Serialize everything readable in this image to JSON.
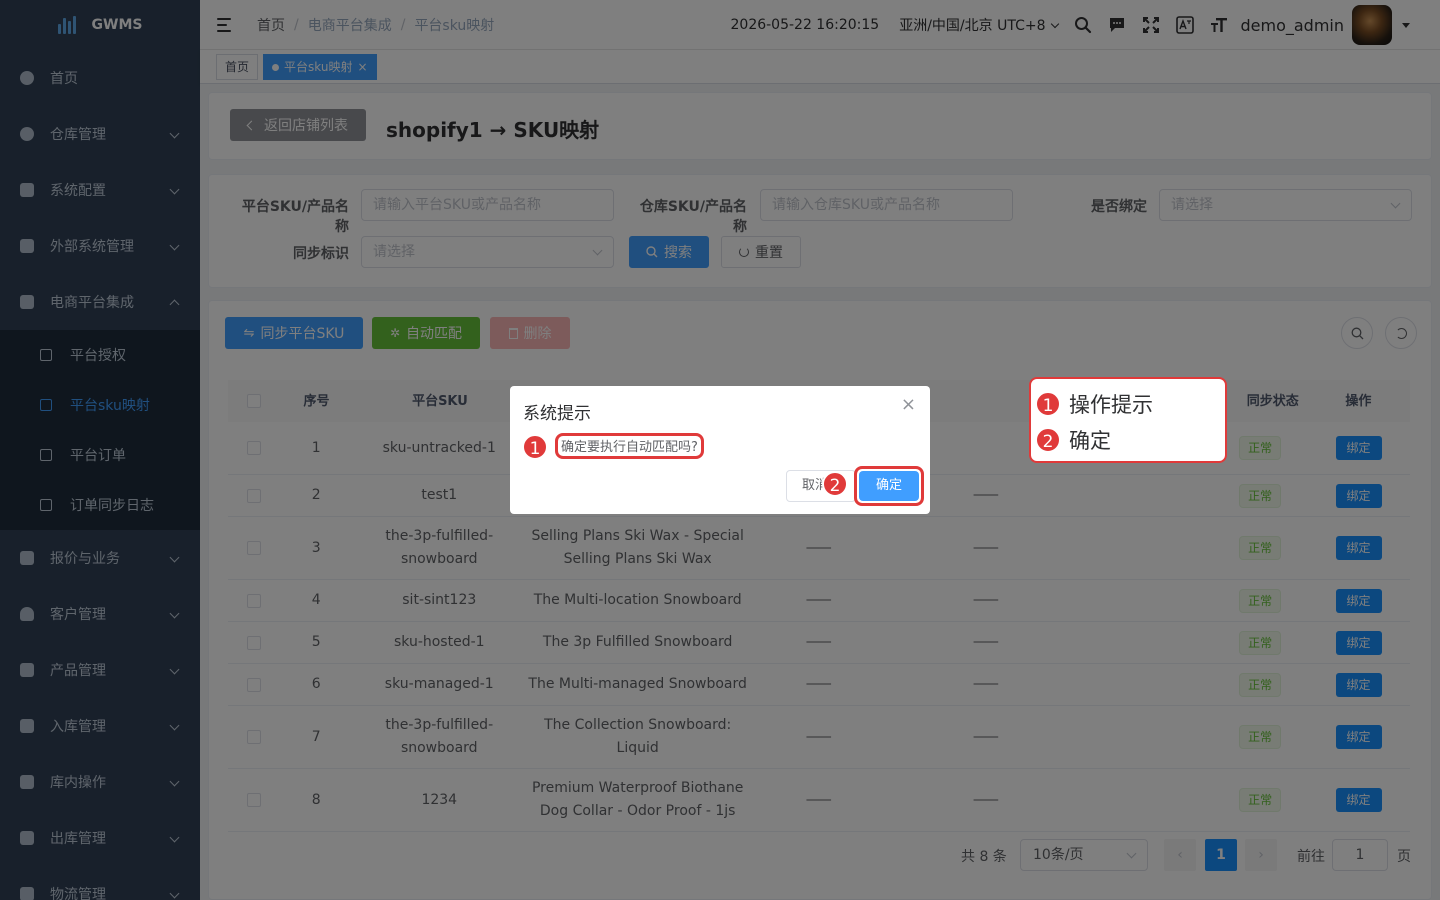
{
  "app": {
    "name": "GWMS"
  },
  "sidebar": {
    "items": [
      {
        "label": "首页"
      },
      {
        "label": "仓库管理"
      },
      {
        "label": "系统配置"
      },
      {
        "label": "外部系统管理"
      },
      {
        "label": "电商平台集成"
      }
    ],
    "subitems": [
      {
        "label": "平台授权"
      },
      {
        "label": "平台sku映射"
      },
      {
        "label": "平台订单"
      },
      {
        "label": "订单同步日志"
      }
    ],
    "items_after": [
      {
        "label": "报价与业务"
      },
      {
        "label": "客户管理"
      },
      {
        "label": "产品管理"
      },
      {
        "label": "入库管理"
      },
      {
        "label": "库内操作"
      },
      {
        "label": "出库管理"
      },
      {
        "label": "物流管理"
      }
    ]
  },
  "navbar": {
    "breadcrumb": [
      "首页",
      "电商平台集成",
      "平台sku映射"
    ],
    "separator": "/",
    "datetime": "2026-05-22 16:20:15",
    "timezone": "亚洲/中国/北京 UTC+8",
    "username": "demo_admin"
  },
  "tags": {
    "home": "首页",
    "active": "平台sku映射",
    "close": "×"
  },
  "header": {
    "back_label": "返回店铺列表",
    "title": "shopify1 → SKU映射"
  },
  "filters": {
    "platform_label": "平台SKU/产品名称",
    "platform_placeholder": "请输入平台SKU或产品名称",
    "warehouse_label": "仓库SKU/产品名称",
    "warehouse_placeholder": "请输入仓库SKU或产品名称",
    "bound_label": "是否绑定",
    "bound_placeholder": "请选择",
    "sync_label": "同步标识",
    "sync_placeholder": "请选择",
    "search_label": "搜索",
    "reset_label": "重置"
  },
  "toolbar": {
    "sync_label": "同步平台SKU",
    "auto_label": "自动匹配",
    "delete_label": "删除"
  },
  "table": {
    "headers": {
      "index": "序号",
      "sku": "平台SKU",
      "sync": "同步状态",
      "op": "操作"
    },
    "rows": [
      {
        "index": "1",
        "sku": "sku-untracked-1",
        "name": "",
        "wsku": "",
        "wname": "",
        "status": "正常",
        "op": "绑定"
      },
      {
        "index": "2",
        "sku": "test1",
        "name": "",
        "wsku": "",
        "wname": "——",
        "status": "正常",
        "op": "绑定"
      },
      {
        "index": "3",
        "sku": "the-3p-fulfilled-snowboard",
        "name": "Selling Plans Ski Wax - Special Selling Plans Ski Wax",
        "wsku": "——",
        "wname": "——",
        "status": "正常",
        "op": "绑定"
      },
      {
        "index": "4",
        "sku": "sit-sint123",
        "name": "The Multi-location Snowboard",
        "wsku": "——",
        "wname": "——",
        "status": "正常",
        "op": "绑定"
      },
      {
        "index": "5",
        "sku": "sku-hosted-1",
        "name": "The 3p Fulfilled Snowboard",
        "wsku": "——",
        "wname": "——",
        "status": "正常",
        "op": "绑定"
      },
      {
        "index": "6",
        "sku": "sku-managed-1",
        "name": "The Multi-managed Snowboard",
        "wsku": "——",
        "wname": "——",
        "status": "正常",
        "op": "绑定"
      },
      {
        "index": "7",
        "sku": "the-3p-fulfilled-snowboard",
        "name": "The Collection Snowboard: Liquid",
        "wsku": "——",
        "wname": "——",
        "status": "正常",
        "op": "绑定"
      },
      {
        "index": "8",
        "sku": "1234",
        "name": "Premium Waterproof Biothane Dog Collar - Odor Proof - 1js",
        "wsku": "——",
        "wname": "——",
        "status": "正常",
        "op": "绑定"
      }
    ]
  },
  "pagination": {
    "total": "共 8 条",
    "page_size": "10条/页",
    "current": "1",
    "goto_label": "前往",
    "goto_value": "1",
    "page_suffix": "页",
    "prev": "‹",
    "next": "›"
  },
  "dialog": {
    "title": "系统提示",
    "message": "确定要执行自动匹配吗?",
    "cancel_label": "取消",
    "ok_label": "确定",
    "close": "×"
  },
  "annotations": {
    "badge1": "1",
    "badge2": "2",
    "legend": [
      {
        "num": "1",
        "text": "操作提示"
      },
      {
        "num": "2",
        "text": "确定"
      }
    ]
  },
  "colors": {
    "sidebar_bg": "#304156",
    "accent": "#409eff",
    "success": "#67c23a",
    "highlight": "#e03a3a"
  }
}
